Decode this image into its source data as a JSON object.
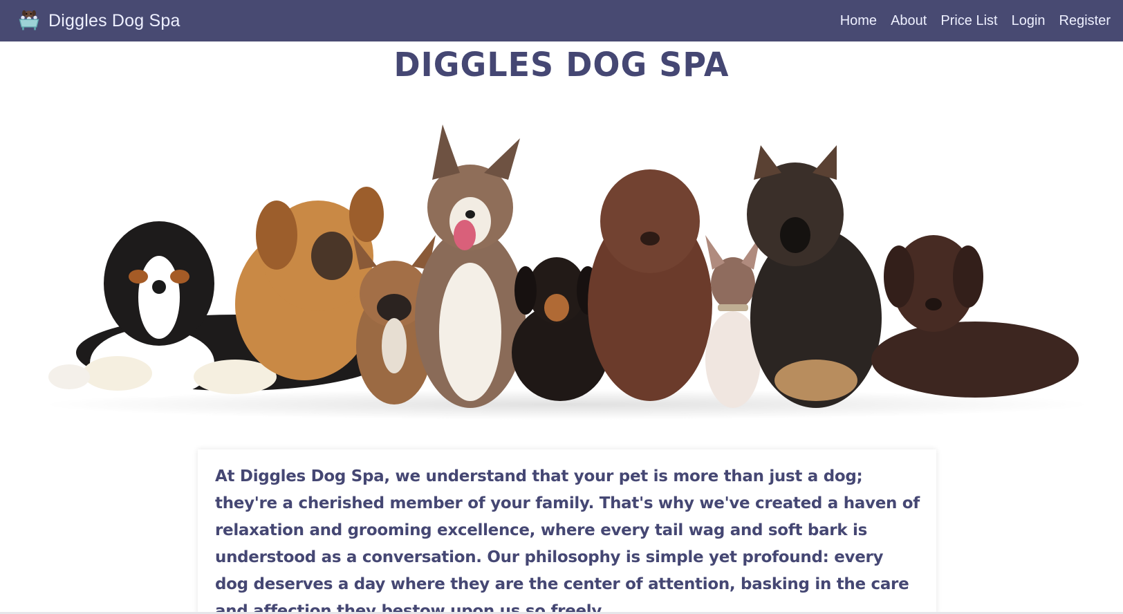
{
  "brand": {
    "name": "Diggles Dog Spa",
    "logo_icon": "dog-bath-icon"
  },
  "nav": {
    "items": [
      {
        "label": "Home"
      },
      {
        "label": "About"
      },
      {
        "label": "Price List"
      },
      {
        "label": "Login"
      },
      {
        "label": "Register"
      }
    ]
  },
  "page": {
    "title": "DIGGLES DOG SPA"
  },
  "hero": {
    "image_subject": "group-of-nine-puppies"
  },
  "intro": {
    "text": "At Diggles Dog Spa, we understand that your pet is more than just a dog; they're a cherished member of your family. That's why we've created a haven of relaxation and grooming excellence, where every tail wag and soft bark is understood as a conversation. Our philosophy is simple yet profound: every dog deserves a day where they are the center of attention, basking in the care and affection they bestow upon us so freely."
  },
  "colors": {
    "navbar": "#484a72",
    "heading": "#454773",
    "nav_text": "#eef0ff"
  }
}
